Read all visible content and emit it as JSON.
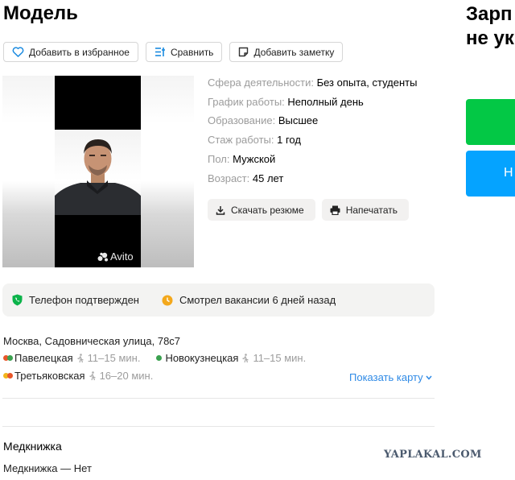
{
  "header": {
    "title": "Модель",
    "right_title_lines": [
      "Зарп",
      "не ук"
    ]
  },
  "toolbar": {
    "favorite_label": "Добавить в избранное",
    "compare_label": "Сравнить",
    "note_label": "Добавить заметку"
  },
  "photo": {
    "watermark": "Avito"
  },
  "facts": [
    {
      "key": "Сфера деятельности:",
      "value": "Без опыта, студенты"
    },
    {
      "key": "График работы:",
      "value": "Неполный день"
    },
    {
      "key": "Образование:",
      "value": "Высшее"
    },
    {
      "key": "Стаж работы:",
      "value": "1 год"
    },
    {
      "key": "Пол:",
      "value": "Мужской"
    },
    {
      "key": "Возраст:",
      "value": "45 лет"
    }
  ],
  "actions": {
    "download_label": "Скачать резюме",
    "print_label": "Напечатать"
  },
  "side_buttons": {
    "blue_label": "Н"
  },
  "status": {
    "phone": "Телефон подтвержден",
    "viewed": "Смотрел вакансии 6 дней назад"
  },
  "address": {
    "text": "Москва, Садовническая улица, 78с7",
    "metro": [
      {
        "name": "Павелецкая",
        "time": "11–15 мин."
      },
      {
        "name": "Новокузнецкая",
        "time": "11–15 мин."
      },
      {
        "name": "Третьяковская",
        "time": "16–20 мин."
      }
    ],
    "map_link": "Показать карту"
  },
  "medical": {
    "title": "Медкнижка",
    "value": "Медкнижка — Нет"
  },
  "watermark_site": "YAPLAKAL.COM",
  "colors": {
    "green": "#03c845",
    "blue": "#05a3ff",
    "link": "#2e8ae6"
  }
}
